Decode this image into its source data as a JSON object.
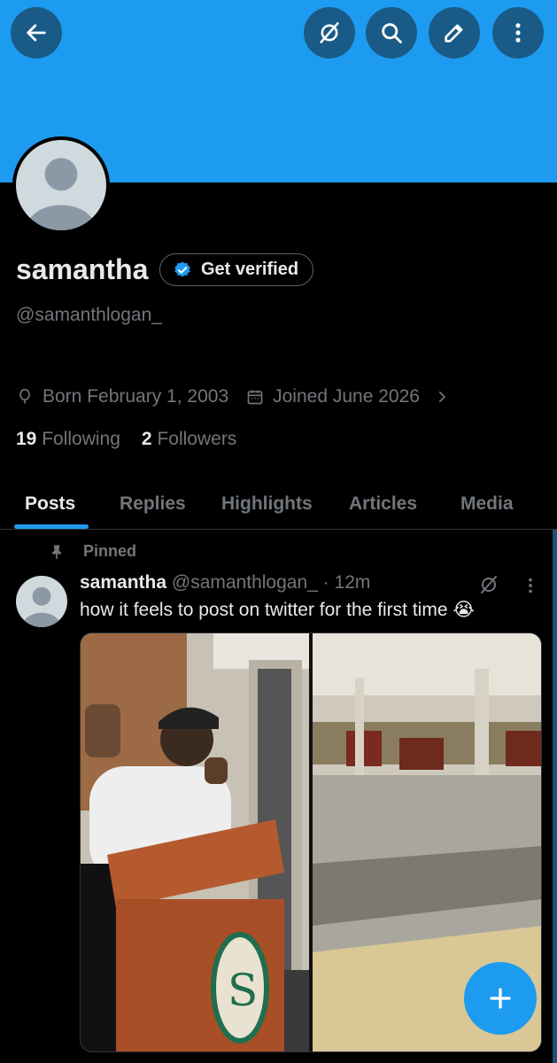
{
  "header": {
    "back_icon": "arrow-left-icon",
    "actions": [
      "grok-icon",
      "search-icon",
      "edit-icon",
      "more-vertical-icon"
    ],
    "banner_color": "#1d9bf0"
  },
  "profile": {
    "name": "samantha",
    "get_verified_label": "Get verified",
    "handle": "@samanthlogan_",
    "born": "Born February 1, 2003",
    "joined": "Joined June 2026",
    "following_count": "19",
    "following_label": "Following",
    "followers_count": "2",
    "followers_label": "Followers"
  },
  "tabs": [
    {
      "label": "Posts",
      "active": true
    },
    {
      "label": "Replies"
    },
    {
      "label": "Highlights"
    },
    {
      "label": "Articles"
    },
    {
      "label": "Media"
    }
  ],
  "post": {
    "pinned_label": "Pinned",
    "author_name": "samantha",
    "author_handle": "@samanthlogan_",
    "separator": "·",
    "time": "12m",
    "text": "how it feels to post on twitter for the first time 😭",
    "media_description_icon": "meme-image"
  },
  "colors": {
    "accent": "#1d9bf0",
    "background": "#000000",
    "muted_text": "#71767b"
  }
}
